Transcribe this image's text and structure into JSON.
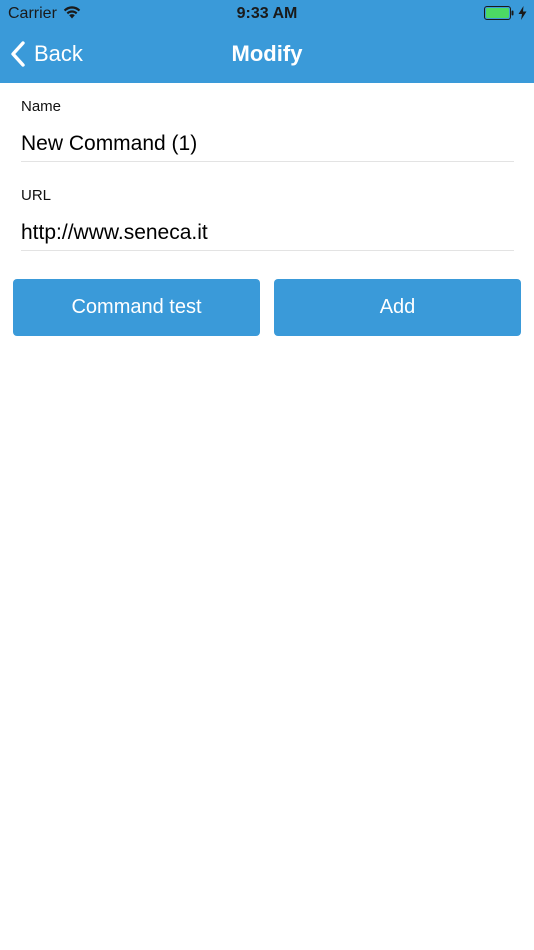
{
  "status_bar": {
    "carrier": "Carrier",
    "time": "9:33 AM",
    "wifi_icon": "wifi-icon",
    "battery_icon": "battery-charging-icon",
    "battery_color": "#4cd964"
  },
  "nav": {
    "back_label": "Back",
    "title": "Modify",
    "bar_color": "#3a9ad9"
  },
  "form": {
    "name_label": "Name",
    "name_value": "New Command (1)",
    "url_label": "URL",
    "url_value": "http://www.seneca.it"
  },
  "actions": {
    "test_label": "Command test",
    "add_label": "Add",
    "button_color": "#3a9ad9"
  }
}
